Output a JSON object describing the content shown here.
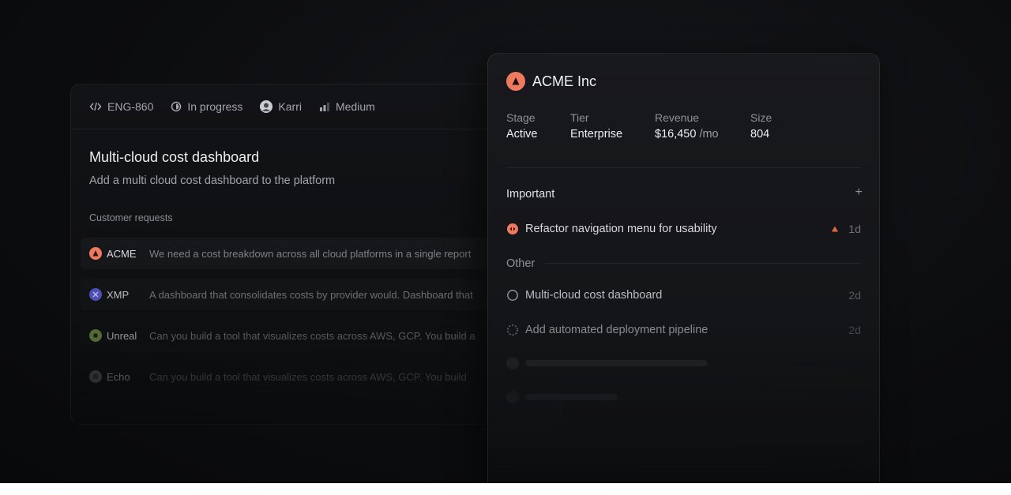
{
  "issue": {
    "id": "ENG-860",
    "status": "In progress",
    "assignee": "Karri",
    "priority": "Medium",
    "title": "Multi-cloud cost dashboard",
    "description": "Add a multi cloud cost dashboard to the platform",
    "requests_label": "Customer requests",
    "requests": [
      {
        "customer": "ACME",
        "text": "We need a cost breakdown across all cloud platforms in a single report",
        "color": "#f07a5f"
      },
      {
        "customer": "XMP",
        "text": "A dashboard that consolidates costs by provider would. Dashboard that",
        "color": "#5b5bd6"
      },
      {
        "customer": "Unreal",
        "text": "Can you build a tool that visualizes costs across AWS, GCP. You build a",
        "color": "#7b9a48"
      },
      {
        "customer": "Echo",
        "text": "Can you build a tool that visualizes costs across AWS, GCP. You build",
        "color": "#6b6e75"
      }
    ]
  },
  "customer": {
    "name": "ACME Inc",
    "stats": {
      "stage_label": "Stage",
      "stage": "Active",
      "tier_label": "Tier",
      "tier": "Enterprise",
      "revenue_label": "Revenue",
      "revenue": "$16,450",
      "revenue_unit": "/mo",
      "size_label": "Size",
      "size": "804"
    },
    "important_label": "Important",
    "add_icon": "+",
    "important": [
      {
        "title": "Refactor navigation menu for usability",
        "age": "1d",
        "priority_color": "#e06c3c"
      }
    ],
    "other_label": "Other",
    "other": [
      {
        "title": "Multi-cloud cost dashboard",
        "age": "2d"
      },
      {
        "title": "Add automated deployment pipeline",
        "age": "2d"
      }
    ]
  },
  "colors": {
    "accent": "#f07a5f",
    "background": "#0c0d0f"
  }
}
